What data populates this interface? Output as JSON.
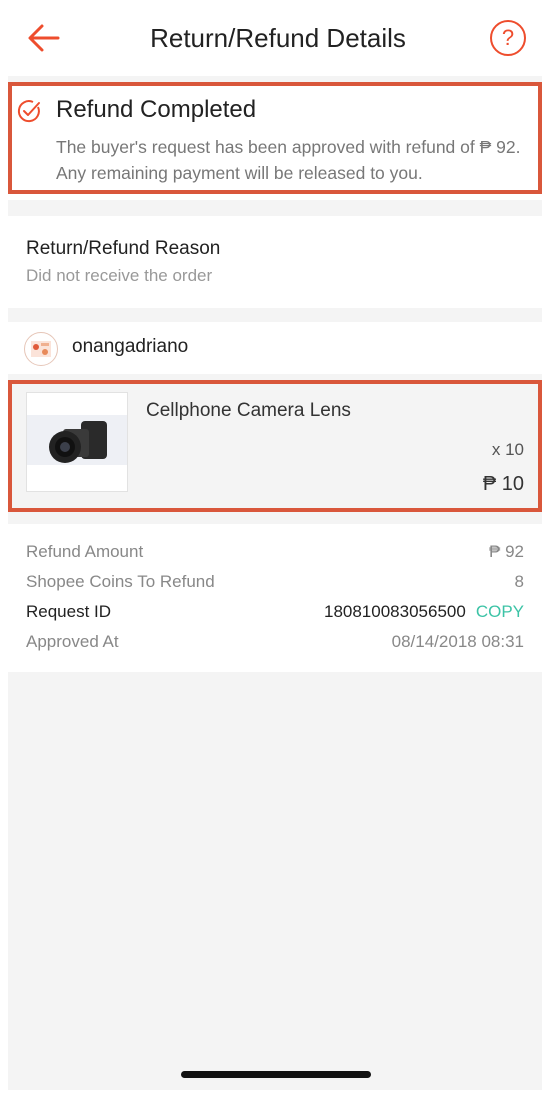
{
  "header": {
    "title": "Return/Refund Details",
    "help_label": "?"
  },
  "status": {
    "heading": "Refund Completed",
    "description": "The buyer's request has been approved with refund of ₱ 92. Any remaining payment will be released to you."
  },
  "reason": {
    "label": "Return/Refund Reason",
    "value": "Did not receive the order"
  },
  "seller": {
    "name": "onangadriano"
  },
  "product": {
    "name": "Cellphone Camera Lens",
    "quantity": "x 10",
    "price": "₱ 10"
  },
  "details": {
    "refund_amount_label": "Refund Amount",
    "refund_amount_value": "₱ 92",
    "coins_label": "Shopee Coins To Refund",
    "coins_value": "8",
    "request_id_label": "Request ID",
    "request_id_value": "180810083056500",
    "copy_label": "COPY",
    "approved_label": "Approved At",
    "approved_value": "08/14/2018 08:31"
  },
  "colors": {
    "accent": "#ee4d2d",
    "highlight_border": "#d9573b",
    "copy": "#3cc3a6"
  },
  "icons": {
    "back": "back-arrow-icon",
    "help": "question-mark-icon",
    "status": "check-circle-icon"
  }
}
